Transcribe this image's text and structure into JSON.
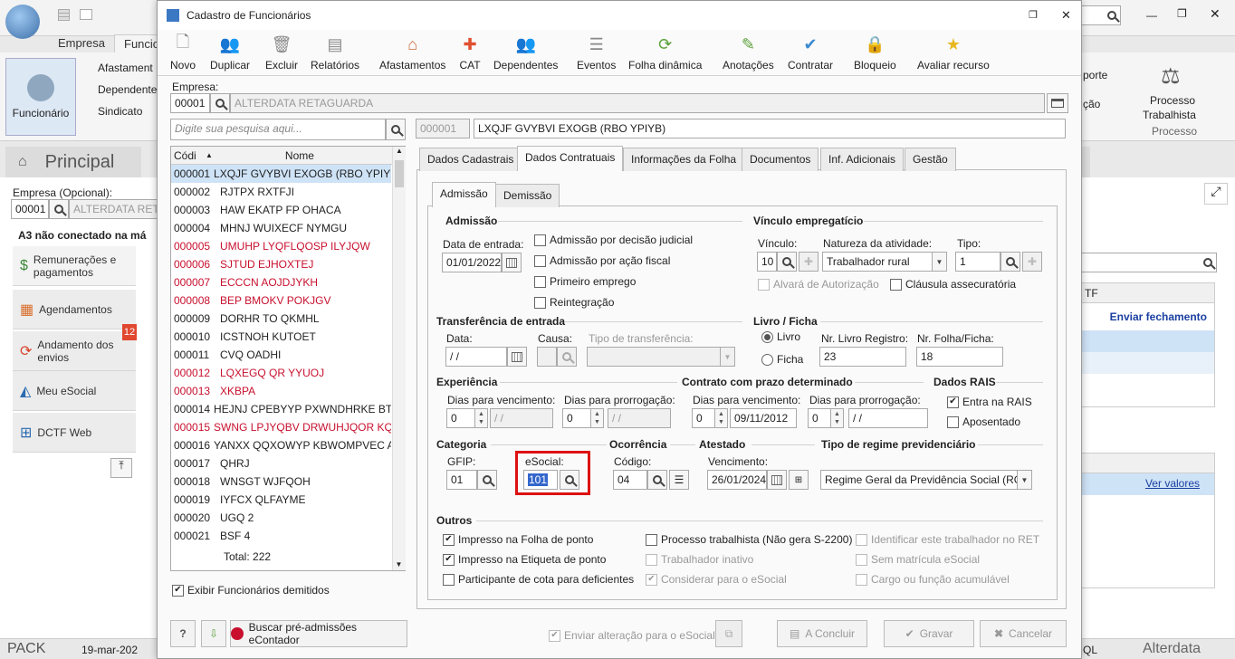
{
  "background": {
    "tabs": [
      "Empresa",
      "Funcio"
    ],
    "ribbon": {
      "funcionario": "Funcionário",
      "afastamentos": "Afastament",
      "dependentes": "Dependente",
      "sindicato": "Sindicato",
      "porte": "porte",
      "cao": "ção",
      "processo": "Processo",
      "trabalhista": "Trabalhista",
      "processo_group": "Processo"
    },
    "principal": "Principal",
    "empresa_opcional_label": "Empresa (Opcional):",
    "empresa_code": "00001",
    "empresa_name": "ALTERDATA RETA",
    "a3_msg": "A3 não conectado na má",
    "nav": [
      {
        "label": "Remunerações e pagamentos"
      },
      {
        "label": "Agendamentos"
      },
      {
        "label": "Andamento dos envios",
        "badge": "12"
      },
      {
        "label": "Meu eSocial"
      },
      {
        "label": "DCTF Web"
      }
    ],
    "right": {
      "col_head": "TF",
      "enviar": "Enviar fechamento",
      "ver_valores": "Ver valores"
    },
    "status": {
      "pack": "PACK",
      "date": "19-mar-202",
      "sql": "QL",
      "brand": "Alterdata"
    }
  },
  "dialog": {
    "title": "Cadastro de Funcionários",
    "toolbar": [
      "Novo",
      "Duplicar",
      "Excluir",
      "Relatórios",
      "Afastamentos",
      "CAT",
      "Dependentes",
      "Eventos",
      "Folha dinâmica",
      "Anotações",
      "Contratar",
      "Bloqueio",
      "Avaliar recurso"
    ],
    "empresa_label": "Empresa:",
    "empresa_code": "00001",
    "empresa_name": "ALTERDATA RETAGUARDA",
    "search_placeholder": "Digite sua pesquisa aqui...",
    "emp_code": "000001",
    "emp_name": "LXQJF GVYBVI EXOGB (RBO YPIYB)",
    "list_head": {
      "code": "Códi",
      "name": "Nome"
    },
    "employees": [
      {
        "code": "000001",
        "name": "LXQJF GVYBVI EXOGB (RBO YPIYB)",
        "red": false
      },
      {
        "code": "000002",
        "name": "RJTPX RXTFJI",
        "red": false
      },
      {
        "code": "000003",
        "name": "HAW EKATP FP OHACA",
        "red": false
      },
      {
        "code": "000004",
        "name": "MHNJ WUIXECF NYMGU",
        "red": false
      },
      {
        "code": "000005",
        "name": "UMUHP LYQFLQOSP ILYJQW",
        "red": true
      },
      {
        "code": "000006",
        "name": "SJTUD EJHOXTEJ",
        "red": true
      },
      {
        "code": "000007",
        "name": "ECCCN AOJDJYKH",
        "red": true
      },
      {
        "code": "000008",
        "name": "BEP BMOKV POKJGV",
        "red": true
      },
      {
        "code": "000009",
        "name": "DORHR TO QKMHL",
        "red": false
      },
      {
        "code": "000010",
        "name": "ICSTNOH KUTOET",
        "red": false
      },
      {
        "code": "000011",
        "name": "CVQ OADHI",
        "red": false
      },
      {
        "code": "000012",
        "name": "LQXEGQ QR YYUOJ",
        "red": true
      },
      {
        "code": "000013",
        "name": "XKBPA",
        "red": true
      },
      {
        "code": "000014",
        "name": "HEJNJ CPEBYYP PXWNDHRKE BTB J",
        "red": false
      },
      {
        "code": "000015",
        "name": "SWNG LPJYQBV DRWUHJQOR KQI Y",
        "red": true
      },
      {
        "code": "000016",
        "name": "YANXX QQXOWYP KBWOMPVEC A",
        "red": false
      },
      {
        "code": "000017",
        "name": "QHRJ",
        "red": false
      },
      {
        "code": "000018",
        "name": "WNSGT WJFQOH",
        "red": false
      },
      {
        "code": "000019",
        "name": "IYFCX QLFAYME",
        "red": false
      },
      {
        "code": "000020",
        "name": "UGQ 2",
        "red": false
      },
      {
        "code": "000021",
        "name": "BSF 4",
        "red": false
      }
    ],
    "total": "Total: 222",
    "exibir_demitidos": "Exibir Funcionários demitidos",
    "buscar": "Buscar pré-admissões eContador",
    "tabs": [
      "Dados Cadastrais",
      "Dados Contratuais",
      "Informações da Folha",
      "Documentos",
      "Inf. Adicionais",
      "Gestão"
    ],
    "subtabs": [
      "Admissão",
      "Demissão"
    ],
    "admissao": {
      "title": "Admissão",
      "data_label": "Data de entrada:",
      "data": "01/01/2022",
      "checks": [
        "Admissão por decisão judicial",
        "Admissão por ação fiscal",
        "Primeiro emprego",
        "Reintegração"
      ]
    },
    "vinculo": {
      "title": "Vínculo empregatício",
      "vinculo_label": "Vínculo:",
      "vinculo": "10",
      "natureza_label": "Natureza da atividade:",
      "natureza": "Trabalhador rural",
      "tipo_label": "Tipo:",
      "tipo": "1",
      "alvara": "Alvará de Autorização",
      "clausula": "Cláusula assecuratória"
    },
    "transferencia": {
      "title": "Transferência de entrada",
      "data_label": "Data:",
      "data": " /  /",
      "causa_label": "Causa:",
      "tipo_label": "Tipo de transferência:"
    },
    "livro": {
      "title": "Livro / Ficha",
      "livro": "Livro",
      "ficha": "Ficha",
      "nr_livro_label": "Nr. Livro Registro:",
      "nr_livro": "23",
      "nr_folha_label": "Nr. Folha/Ficha:",
      "nr_folha": "18"
    },
    "experiencia": {
      "title": "Experiência",
      "venc_label": "Dias para vencimento:",
      "venc": "0",
      "venc_date": " /  /",
      "prorr_label": "Dias para prorrogação:",
      "prorr": "0",
      "prorr_date": " /  /"
    },
    "contrato": {
      "title": "Contrato com prazo determinado",
      "venc_label": "Dias para vencimento:",
      "venc": "0",
      "venc_date": "09/11/2012",
      "prorr_label": "Dias para prorrogação:",
      "prorr": "0",
      "prorr_date": " /  /"
    },
    "rais": {
      "title": "Dados RAIS",
      "entra": "Entra na RAIS",
      "aposentado": "Aposentado"
    },
    "categoria": {
      "title": "Categoria",
      "gfip_label": "GFIP:",
      "gfip": "01",
      "esocial_label": "eSocial:",
      "esocial": "101"
    },
    "ocorrencia": {
      "title": "Ocorrência",
      "codigo_label": "Código:",
      "codigo": "04"
    },
    "atestado": {
      "title": "Atestado",
      "venc_label": "Vencimento:",
      "venc": "26/01/2024"
    },
    "regime": {
      "title": "Tipo de regime previdenciário",
      "value": "Regime Geral da Previdência Social (RGP"
    },
    "outros": {
      "title": "Outros",
      "c1": [
        "Impresso na Folha de ponto",
        "Impresso na Etiqueta de ponto",
        "Participante de cota para deficientes"
      ],
      "c2": [
        "Processo trabalhista (Não gera S-2200)",
        "Trabalhador inativo",
        "Considerar para o eSocial"
      ],
      "c3": [
        "Identificar este trabalhador no RET",
        "Sem matrícula eSocial",
        "Cargo ou função acumulável"
      ]
    },
    "footer": {
      "enviar": "Enviar alteração para o eSocial",
      "concluir": "A Concluir",
      "gravar": "Gravar",
      "cancelar": "Cancelar"
    },
    "colors": {
      "highlight": "#dd1111",
      "selected": "#cfe3f7",
      "red_text": "#c8102e",
      "link": "#1a3fa0"
    }
  }
}
